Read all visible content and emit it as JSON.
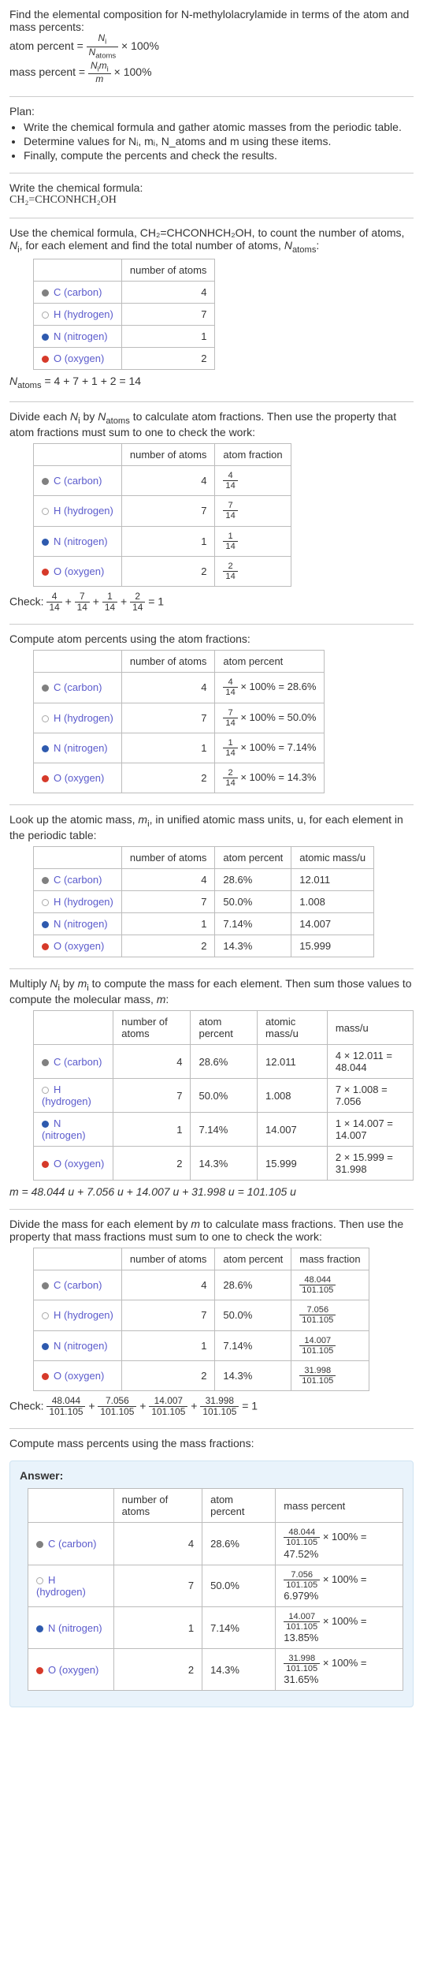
{
  "intro": {
    "line1": "Find the elemental composition for N-methylolacrylamide in terms of the atom and mass percents:",
    "atom_percent_label": "atom percent = ",
    "atom_percent_tail": " × 100%",
    "mass_percent_label": "mass percent = ",
    "mass_percent_tail": " × 100%",
    "Ni": "N",
    "Ni_sub": "i",
    "Natoms": "N",
    "Natoms_sub": "atoms",
    "Nimi_num1": "N",
    "Nimi_num1_sub": "i",
    "Nimi_num2": "m",
    "Nimi_num2_sub": "i",
    "m": "m"
  },
  "plan": {
    "title": "Plan:",
    "items": [
      "Write the chemical formula and gather atomic masses from the periodic table.",
      "Determine values for Nᵢ, mᵢ, N_atoms and m using these items.",
      "Finally, compute the percents and check the results."
    ]
  },
  "formula_section": {
    "title": "Write the chemical formula:",
    "formula": "CH₂=CHCONHCH₂OH"
  },
  "count_section": {
    "intro_a": "Use the chemical formula, CH₂=CHCONHCH₂OH, to count the number of atoms, ",
    "intro_b": ", for each element and find the total number of atoms, ",
    "intro_c": ":",
    "Ni": "N",
    "Ni_sub": "i",
    "Natoms": "N",
    "Natoms_sub": "atoms",
    "header_atoms": "number of atoms",
    "rows": [
      {
        "elem": "C (carbon)",
        "cls": "carbon",
        "n": "4"
      },
      {
        "elem": "H (hydrogen)",
        "cls": "hydrogen",
        "n": "7"
      },
      {
        "elem": "N (nitrogen)",
        "cls": "nitrogen",
        "n": "1"
      },
      {
        "elem": "O (oxygen)",
        "cls": "oxygen",
        "n": "2"
      }
    ],
    "total_label": "N",
    "total_sub": "atoms",
    "total_expr": " = 4 + 7 + 1 + 2 = 14"
  },
  "atom_fraction_section": {
    "intro_a": "Divide each ",
    "intro_b": " by ",
    "intro_c": " to calculate atom fractions. Then use the property that atom fractions must sum to one to check the work:",
    "Ni": "N",
    "Ni_sub": "i",
    "Natoms": "N",
    "Natoms_sub": "atoms",
    "header_atoms": "number of atoms",
    "header_frac": "atom fraction",
    "rows": [
      {
        "elem": "C (carbon)",
        "cls": "carbon",
        "n": "4",
        "num": "4",
        "den": "14"
      },
      {
        "elem": "H (hydrogen)",
        "cls": "hydrogen",
        "n": "7",
        "num": "7",
        "den": "14"
      },
      {
        "elem": "N (nitrogen)",
        "cls": "nitrogen",
        "n": "1",
        "num": "1",
        "den": "14"
      },
      {
        "elem": "O (oxygen)",
        "cls": "oxygen",
        "n": "2",
        "num": "2",
        "den": "14"
      }
    ],
    "check_label": "Check: ",
    "check_tail": " = 1"
  },
  "atom_percent_section": {
    "intro": "Compute atom percents using the atom fractions:",
    "header_atoms": "number of atoms",
    "header_pct": "atom percent",
    "rows": [
      {
        "elem": "C (carbon)",
        "cls": "carbon",
        "n": "4",
        "num": "4",
        "den": "14",
        "res": " × 100% = 28.6%"
      },
      {
        "elem": "H (hydrogen)",
        "cls": "hydrogen",
        "n": "7",
        "num": "7",
        "den": "14",
        "res": " × 100% = 50.0%"
      },
      {
        "elem": "N (nitrogen)",
        "cls": "nitrogen",
        "n": "1",
        "num": "1",
        "den": "14",
        "res": " × 100% = 7.14%"
      },
      {
        "elem": "O (oxygen)",
        "cls": "oxygen",
        "n": "2",
        "num": "2",
        "den": "14",
        "res": " × 100% = 14.3%"
      }
    ]
  },
  "atomic_mass_section": {
    "intro_a": "Look up the atomic mass, ",
    "intro_b": ", in unified atomic mass units, u, for each element in the periodic table:",
    "mi": "m",
    "mi_sub": "i",
    "header_atoms": "number of atoms",
    "header_pct": "atom percent",
    "header_mass": "atomic mass/u",
    "rows": [
      {
        "elem": "C (carbon)",
        "cls": "carbon",
        "n": "4",
        "pct": "28.6%",
        "mass": "12.011"
      },
      {
        "elem": "H (hydrogen)",
        "cls": "hydrogen",
        "n": "7",
        "pct": "50.0%",
        "mass": "1.008"
      },
      {
        "elem": "N (nitrogen)",
        "cls": "nitrogen",
        "n": "1",
        "pct": "7.14%",
        "mass": "14.007"
      },
      {
        "elem": "O (oxygen)",
        "cls": "oxygen",
        "n": "2",
        "pct": "14.3%",
        "mass": "15.999"
      }
    ]
  },
  "mass_calc_section": {
    "intro_a": "Multiply ",
    "intro_b": " by ",
    "intro_c": " to compute the mass for each element. Then sum those values to compute the molecular mass, ",
    "intro_d": ":",
    "Ni": "N",
    "Ni_sub": "i",
    "mi": "m",
    "mi_sub": "i",
    "m": "m",
    "header_atoms": "number of atoms",
    "header_pct": "atom percent",
    "header_mass": "atomic mass/u",
    "header_massu": "mass/u",
    "rows": [
      {
        "elem": "C (carbon)",
        "cls": "carbon",
        "n": "4",
        "pct": "28.6%",
        "mass": "12.011",
        "calc": "4 × 12.011 = 48.044"
      },
      {
        "elem": "H (hydrogen)",
        "cls": "hydrogen",
        "n": "7",
        "pct": "50.0%",
        "mass": "1.008",
        "calc": "7 × 1.008 = 7.056"
      },
      {
        "elem": "N (nitrogen)",
        "cls": "nitrogen",
        "n": "1",
        "pct": "7.14%",
        "mass": "14.007",
        "calc": "1 × 14.007 = 14.007"
      },
      {
        "elem": "O (oxygen)",
        "cls": "oxygen",
        "n": "2",
        "pct": "14.3%",
        "mass": "15.999",
        "calc": "2 × 15.999 = 31.998"
      }
    ],
    "total": "m = 48.044 u + 7.056 u + 14.007 u + 31.998 u = 101.105 u"
  },
  "mass_fraction_section": {
    "intro_a": "Divide the mass for each element by ",
    "intro_b": " to calculate mass fractions. Then use the property that mass fractions must sum to one to check the work:",
    "m": "m",
    "header_atoms": "number of atoms",
    "header_pct": "atom percent",
    "header_frac": "mass fraction",
    "rows": [
      {
        "elem": "C (carbon)",
        "cls": "carbon",
        "n": "4",
        "pct": "28.6%",
        "num": "48.044",
        "den": "101.105"
      },
      {
        "elem": "H (hydrogen)",
        "cls": "hydrogen",
        "n": "7",
        "pct": "50.0%",
        "num": "7.056",
        "den": "101.105"
      },
      {
        "elem": "N (nitrogen)",
        "cls": "nitrogen",
        "n": "1",
        "pct": "7.14%",
        "num": "14.007",
        "den": "101.105"
      },
      {
        "elem": "O (oxygen)",
        "cls": "oxygen",
        "n": "2",
        "pct": "14.3%",
        "num": "31.998",
        "den": "101.105"
      }
    ],
    "check_label": "Check: ",
    "check_tail": " = 1"
  },
  "mass_percent_section": {
    "intro": "Compute mass percents using the mass fractions:"
  },
  "answer": {
    "title": "Answer:",
    "header_atoms": "number of atoms",
    "header_pct": "atom percent",
    "header_masspct": "mass percent",
    "rows": [
      {
        "elem": "C (carbon)",
        "cls": "carbon",
        "n": "4",
        "pct": "28.6%",
        "num": "48.044",
        "den": "101.105",
        "res": " × 100% = 47.52%"
      },
      {
        "elem": "H (hydrogen)",
        "cls": "hydrogen",
        "n": "7",
        "pct": "50.0%",
        "num": "7.056",
        "den": "101.105",
        "res": " × 100% = 6.979%"
      },
      {
        "elem": "N (nitrogen)",
        "cls": "nitrogen",
        "n": "1",
        "pct": "7.14%",
        "num": "14.007",
        "den": "101.105",
        "res": " × 100% = 13.85%"
      },
      {
        "elem": "O (oxygen)",
        "cls": "oxygen",
        "n": "2",
        "pct": "14.3%",
        "num": "31.998",
        "den": "101.105",
        "res": " × 100% = 31.65%"
      }
    ]
  }
}
